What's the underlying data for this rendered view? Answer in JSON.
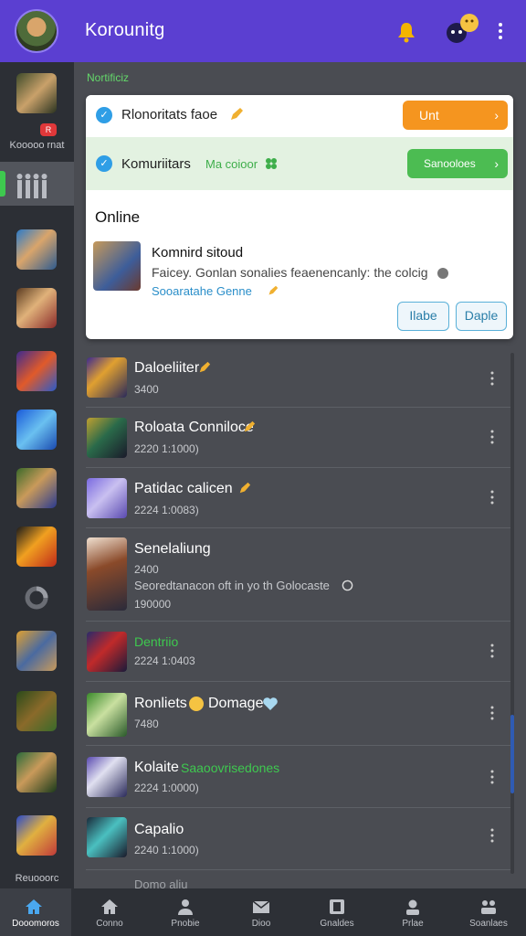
{
  "colors": {
    "header": "#5b3fd1",
    "accent_green": "#3ec94f",
    "accent_orange": "#f5951f",
    "accent_blue": "#2f9ee6",
    "list_bg": "#4a4c52",
    "rail_bg": "#2c2f35"
  },
  "header": {
    "title": "Korounitg",
    "bell_icon": "bell-icon",
    "emoji_icon": "emoji-icon",
    "menu_icon": "kebab-icon"
  },
  "rail": {
    "labels": {
      "first": "Kooooo rnat",
      "last": "Reuooorc"
    },
    "badge": "R"
  },
  "main": {
    "section_label": "Nortificiz",
    "card": {
      "row1": {
        "text": "Rlonoritats faoe",
        "button": "Unt"
      },
      "row2": {
        "text": "Komuriitars",
        "tag": "Ma coioor",
        "button": "Sanooloes"
      },
      "heading": "Online",
      "entry": {
        "title": "Komnird sitoud",
        "description": "Faicey. Gonlan sonalies feaenencanly: the colcig",
        "link": "Sooaratahe Genne"
      },
      "buttons": {
        "left": "Ilabe",
        "right": "Daple"
      }
    },
    "items": [
      {
        "title": "Daloeliiter",
        "sub": "3400"
      },
      {
        "title": "Roloata Conniloce",
        "sub": "2220 1:1000)"
      },
      {
        "title": "Patidac calicen",
        "sub": "2224 1:0083)"
      },
      {
        "title": "Senelaliung",
        "sub": "2400",
        "sub2": "Seoredtanacon oft in yo th Golocaste",
        "sub3": "190000"
      },
      {
        "title": "Dentriio",
        "sub": "2224 1:0403"
      },
      {
        "title": "Ronliets",
        "title_suffix": "Domage",
        "sub": "7480"
      },
      {
        "title": "Kolaite",
        "title_green": "Saaoovrisedones",
        "sub": "2224 1:0000)"
      },
      {
        "title": "Capalio",
        "sub": "2240 1:1000)"
      }
    ],
    "peek_title": "Domo aliu"
  },
  "bottom_nav": [
    {
      "label": "Dooomoros",
      "icon": "home-icon"
    },
    {
      "label": "Conno",
      "icon": "home-outline-icon"
    },
    {
      "label": "Pnobie",
      "icon": "person-icon"
    },
    {
      "label": "Dioo",
      "icon": "mail-icon"
    },
    {
      "label": "Gnaldes",
      "icon": "tablet-icon"
    },
    {
      "label": "Prlae",
      "icon": "profile-icon"
    },
    {
      "label": "Soanlaes",
      "icon": "group-icon"
    }
  ]
}
